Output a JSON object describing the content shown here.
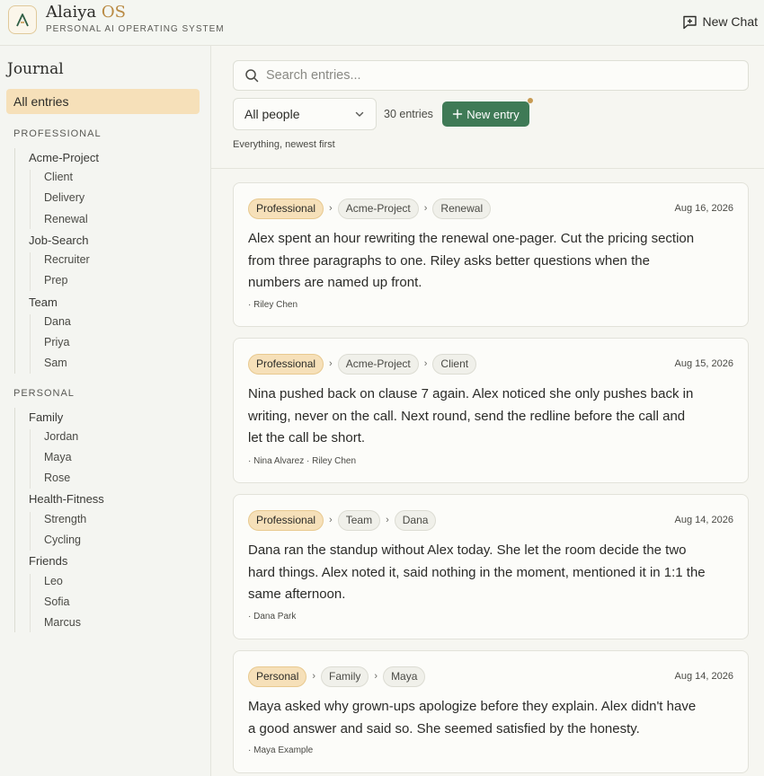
{
  "header": {
    "brand_main": "Alaiya",
    "brand_os": "OS",
    "brand_sub": "PERSONAL AI OPERATING SYSTEM",
    "new_chat": "New Chat"
  },
  "sidebar": {
    "title": "Journal",
    "all_entries": "All entries",
    "professional_label": "PROFESSIONAL",
    "professional": [
      {
        "label": "Acme-Project",
        "children": [
          "Client",
          "Delivery",
          "Renewal"
        ]
      },
      {
        "label": "Job-Search",
        "children": [
          "Recruiter",
          "Prep"
        ]
      },
      {
        "label": "Team",
        "children": [
          "Dana",
          "Priya",
          "Sam"
        ]
      }
    ],
    "personal_label": "PERSONAL",
    "personal": [
      {
        "label": "Family",
        "children": [
          "Jordan",
          "Maya",
          "Rose"
        ]
      },
      {
        "label": "Health-Fitness",
        "children": [
          "Strength",
          "Cycling"
        ]
      },
      {
        "label": "Friends",
        "children": [
          "Leo",
          "Sofia",
          "Marcus"
        ]
      }
    ]
  },
  "main": {
    "search_placeholder": "Search entries...",
    "people_filter": "All people",
    "count": "30 entries",
    "new_entry": "New entry",
    "subtitle": "Everything, newest first"
  },
  "entries": [
    {
      "crumbs": [
        "Professional",
        "Acme-Project",
        "Renewal"
      ],
      "date": "Aug 16, 2026",
      "lines": [
        "Alex spent an hour rewriting the renewal one-pager. Cut the pricing section",
        "from three paragraphs to one. Riley asks better questions when the",
        "numbers are named up front."
      ],
      "people": "· Riley Chen"
    },
    {
      "crumbs": [
        "Professional",
        "Acme-Project",
        "Client"
      ],
      "date": "Aug 15, 2026",
      "lines": [
        "Nina pushed back on clause 7 again. Alex noticed she only pushes back in",
        "writing, never on the call. Next round, send the redline before the call and",
        "let the call be short."
      ],
      "people": "· Nina Alvarez · Riley Chen"
    },
    {
      "crumbs": [
        "Professional",
        "Team",
        "Dana"
      ],
      "date": "Aug 14, 2026",
      "lines": [
        "Dana ran the standup without Alex today. She let the room decide the two",
        "hard things. Alex noted it, said nothing in the moment, mentioned it in 1:1 the",
        "same afternoon."
      ],
      "people": "· Dana Park"
    },
    {
      "crumbs": [
        "Personal",
        "Family",
        "Maya"
      ],
      "date": "Aug 14, 2026",
      "lines": [
        "Maya asked why grown-ups apologize before they explain. Alex didn't have",
        "a good answer and said so. She seemed satisfied by the honesty."
      ],
      "people": "· Maya Example"
    }
  ],
  "colors": {
    "accent_green": "#3f7a56",
    "category_pill": "#f6e0b9",
    "brand_gold": "#b98a43"
  }
}
